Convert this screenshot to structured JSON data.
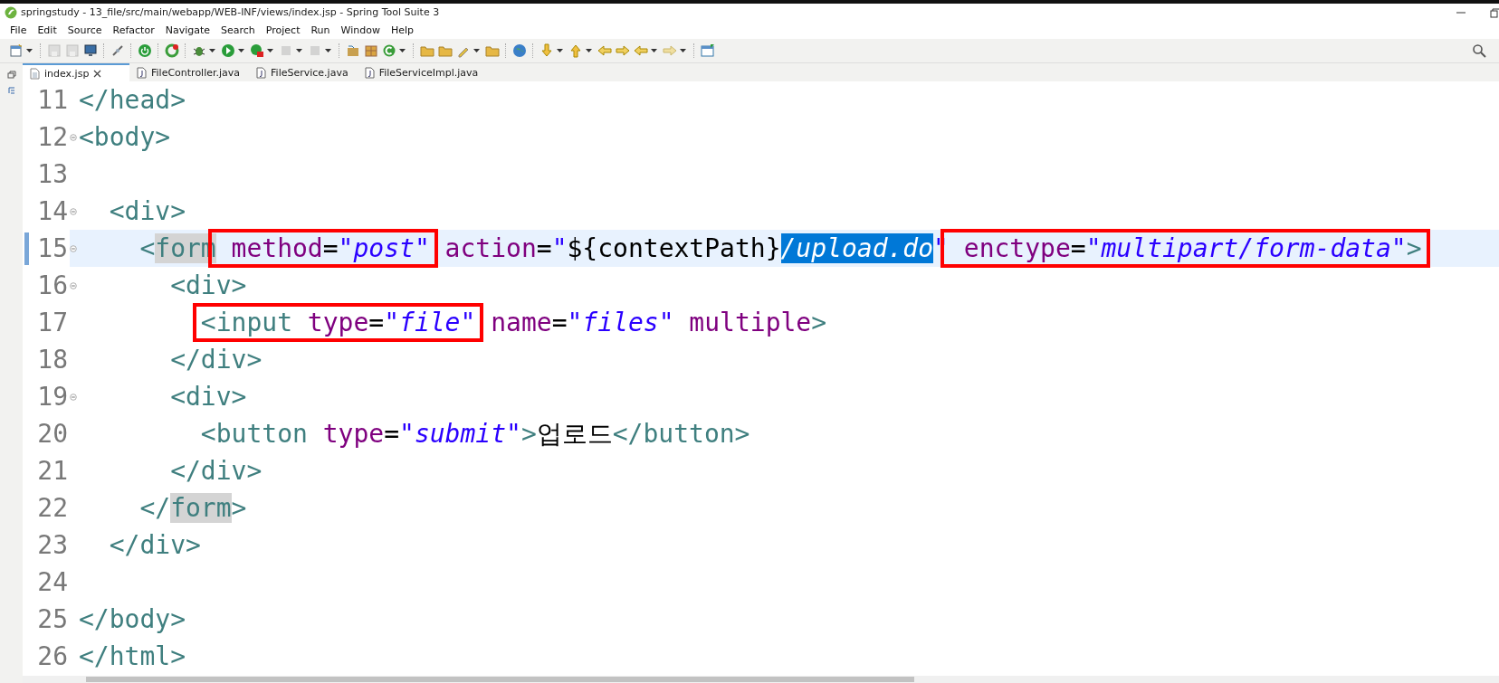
{
  "window": {
    "title": "springstudy - 13_file/src/main/webapp/WEB-INF/views/index.jsp - Spring Tool Suite 3"
  },
  "menu": [
    "File",
    "Edit",
    "Source",
    "Refactor",
    "Navigate",
    "Search",
    "Project",
    "Run",
    "Window",
    "Help"
  ],
  "tabs": [
    {
      "label": "index.jsp",
      "selected": true,
      "kind": "jsp"
    },
    {
      "label": "FileController.java",
      "selected": false,
      "kind": "java"
    },
    {
      "label": "FileService.java",
      "selected": false,
      "kind": "java"
    },
    {
      "label": "FileServiceImpl.java",
      "selected": false,
      "kind": "java"
    }
  ],
  "editor": {
    "lines": [
      {
        "number": "11",
        "fold": false,
        "current": false,
        "segments": [
          {
            "boxed": false,
            "tokens": [
              {
                "kind": "tag",
                "text": "</head>"
              }
            ]
          }
        ]
      },
      {
        "number": "12",
        "fold": true,
        "current": false,
        "segments": [
          {
            "boxed": false,
            "tokens": [
              {
                "kind": "tag",
                "text": "<body>"
              }
            ]
          }
        ],
        "children": [
          {
            "number": "13",
            "fold": false,
            "current": false
          },
          {
            "number": "14",
            "fold": true,
            "current": false,
            "segments": [
              {
                "boxed": false,
                "tokens": [
                  {
                    "kind": "tag",
                    "text": "<div>"
                  }
                ]
              }
            ],
            "children": [
              {
                "number": "15",
                "fold": true,
                "current": true,
                "segments": [
                  {
                    "boxed": false,
                    "tokens": [
                      {
                        "kind": "tag",
                        "text": "<"
                      },
                      {
                        "kind": "occurrence",
                        "text": "form"
                      }
                    ]
                  },
                  {
                    "boxed": true,
                    "tokens": [
                      {
                        "kind": "attr",
                        "text": " method"
                      },
                      {
                        "kind": "plain",
                        "text": "="
                      },
                      {
                        "kind": "string",
                        "text": "\"post\""
                      }
                    ]
                  },
                  {
                    "boxed": false,
                    "tokens": [
                      {
                        "kind": "attr",
                        "text": " action"
                      },
                      {
                        "kind": "plain",
                        "text": "="
                      },
                      {
                        "kind": "string",
                        "text": "\""
                      },
                      {
                        "kind": "plain",
                        "text": "${contextPath}"
                      },
                      {
                        "kind": "selected",
                        "text": "/upload.do"
                      },
                      {
                        "kind": "string",
                        "text": "\""
                      }
                    ]
                  },
                  {
                    "boxed": true,
                    "tokens": [
                      {
                        "kind": "attr",
                        "text": " enctype"
                      },
                      {
                        "kind": "plain",
                        "text": "="
                      },
                      {
                        "kind": "string",
                        "text": "\"multipart/form-data\""
                      },
                      {
                        "kind": "tag",
                        "text": ">"
                      }
                    ]
                  }
                ],
                "children": [
                  {
                    "number": "16",
                    "fold": true,
                    "current": false,
                    "segments": [
                      {
                        "boxed": false,
                        "tokens": [
                          {
                            "kind": "tag",
                            "text": "<div>"
                          }
                        ]
                      }
                    ],
                    "children": [
                      {
                        "number": "17",
                        "fold": false,
                        "current": false,
                        "segments": [
                          {
                            "boxed": true,
                            "tokens": [
                              {
                                "kind": "tag",
                                "text": "<input"
                              },
                              {
                                "kind": "attr",
                                "text": " type"
                              },
                              {
                                "kind": "plain",
                                "text": "="
                              },
                              {
                                "kind": "string",
                                "text": "\"file\""
                              }
                            ]
                          },
                          {
                            "boxed": false,
                            "tokens": [
                              {
                                "kind": "attr",
                                "text": " name"
                              },
                              {
                                "kind": "plain",
                                "text": "="
                              },
                              {
                                "kind": "string",
                                "text": "\"files\""
                              },
                              {
                                "kind": "attr",
                                "text": " multiple"
                              },
                              {
                                "kind": "tag",
                                "text": ">"
                              }
                            ]
                          }
                        ]
                      }
                    ]
                  },
                  {
                    "number": "18",
                    "fold": false,
                    "current": false,
                    "segments": [
                      {
                        "boxed": false,
                        "tokens": [
                          {
                            "kind": "tag",
                            "text": "</div>"
                          }
                        ]
                      }
                    ]
                  },
                  {
                    "number": "19",
                    "fold": true,
                    "current": false,
                    "segments": [
                      {
                        "boxed": false,
                        "tokens": [
                          {
                            "kind": "tag",
                            "text": "<div>"
                          }
                        ]
                      }
                    ],
                    "children": [
                      {
                        "number": "20",
                        "fold": false,
                        "current": false,
                        "segments": [
                          {
                            "boxed": false,
                            "tokens": [
                              {
                                "kind": "tag",
                                "text": "<button"
                              },
                              {
                                "kind": "attr",
                                "text": " type"
                              },
                              {
                                "kind": "plain",
                                "text": "="
                              },
                              {
                                "kind": "string",
                                "text": "\"submit\""
                              },
                              {
                                "kind": "tag",
                                "text": ">"
                              },
                              {
                                "kind": "plain",
                                "text": "업로드"
                              },
                              {
                                "kind": "tag",
                                "text": "</button>"
                              }
                            ]
                          }
                        ]
                      }
                    ]
                  },
                  {
                    "number": "21",
                    "fold": false,
                    "current": false,
                    "segments": [
                      {
                        "boxed": false,
                        "tokens": [
                          {
                            "kind": "tag",
                            "text": "</div>"
                          }
                        ]
                      }
                    ]
                  }
                ]
              },
              {
                "number": "22",
                "fold": false,
                "current": false,
                "segments": [
                  {
                    "boxed": false,
                    "tokens": [
                      {
                        "kind": "tag",
                        "text": "</"
                      },
                      {
                        "kind": "occurrence",
                        "text": "form"
                      },
                      {
                        "kind": "tag",
                        "text": ">"
                      }
                    ]
                  }
                ]
              }
            ]
          },
          {
            "number": "23",
            "fold": false,
            "current": false,
            "segments": [
              {
                "boxed": false,
                "tokens": [
                  {
                    "kind": "tag",
                    "text": "</div>"
                  }
                ]
              }
            ]
          },
          {
            "number": "24",
            "fold": false,
            "current": false
          }
        ]
      },
      {
        "number": "25",
        "fold": false,
        "current": false,
        "segments": [
          {
            "boxed": false,
            "tokens": [
              {
                "kind": "tag",
                "text": "</body>"
              }
            ]
          }
        ]
      },
      {
        "number": "26",
        "fold": false,
        "current": false,
        "segments": [
          {
            "boxed": false,
            "tokens": [
              {
                "kind": "tag",
                "text": "</html>"
              }
            ]
          }
        ]
      }
    ]
  }
}
